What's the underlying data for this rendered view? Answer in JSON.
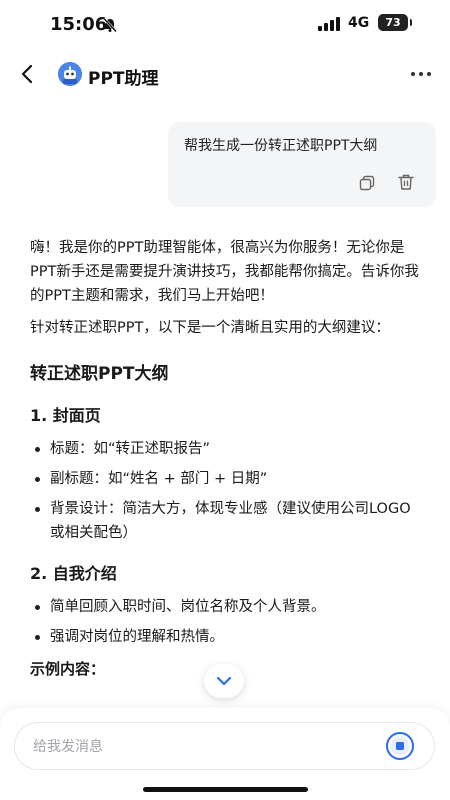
{
  "status_bar": {
    "time": "15:06",
    "network": "4G",
    "battery": "73"
  },
  "header": {
    "title": "PPT助理",
    "avatar_icon": "robot-avatar-icon"
  },
  "user_message": {
    "text": "帮我生成一份转正述职PPT大纲"
  },
  "assistant_message": {
    "intro": "嗨！我是你的PPT助理智能体，很高兴为你服务！无论你是PPT新手还是需要提升演讲技巧，我都能帮你搞定。告诉你我的PPT主题和需求，我们马上开始吧！",
    "lead": "针对转正述职PPT，以下是一个清晰且实用的大纲建议：",
    "outline_title": "转正述职PPT大纲",
    "sections": [
      {
        "heading": "1. 封面页",
        "bullets": [
          "标题：如“转正述职报告”",
          "副标题：如“姓名 + 部门 + 日期”",
          "背景设计：简洁大方，体现专业感（建议使用公司LOGO或相关配色）"
        ]
      },
      {
        "heading": "2. 自我介绍",
        "bullets": [
          "简单回顾入职时间、岗位名称及个人背景。",
          "强调对岗位的理解和热情。"
        ]
      }
    ],
    "example_label": "示例内容："
  },
  "composer": {
    "placeholder": "给我发消息"
  },
  "colors": {
    "accent": "#2f6bf0",
    "bubble_bg": "#f4f5f7"
  }
}
